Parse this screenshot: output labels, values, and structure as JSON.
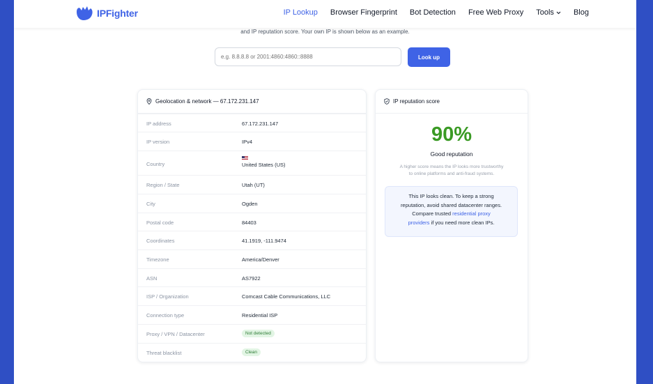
{
  "header": {
    "brand": "IPFighter",
    "nav": [
      {
        "label": "IP Lookup",
        "active": true
      },
      {
        "label": "Browser Fingerprint"
      },
      {
        "label": "Bot Detection"
      },
      {
        "label": "Free Web Proxy"
      },
      {
        "label": "Tools"
      },
      {
        "label": "Blog"
      }
    ]
  },
  "intro": "and IP reputation score. Your own IP is shown below as an example.",
  "search": {
    "placeholder": "e.g. 8.8.8.8 or 2001:4860:4860::8888",
    "button": "Look up"
  },
  "geo": {
    "title": "Geolocation & network — 67.172.231.147",
    "rows": [
      {
        "key": "IP address",
        "value": "67.172.231.147"
      },
      {
        "key": "IP version",
        "value": "IPv4"
      },
      {
        "key": "Country",
        "value": "United States (US)"
      },
      {
        "key": "Region / State",
        "value": "Utah (UT)"
      },
      {
        "key": "City",
        "value": "Ogden"
      },
      {
        "key": "Postal code",
        "value": "84403"
      },
      {
        "key": "Coordinates",
        "value": "41.1919, -111.9474"
      },
      {
        "key": "Timezone",
        "value": "America/Denver"
      },
      {
        "key": "ASN",
        "value": "AS7922"
      },
      {
        "key": "ISP / Organization",
        "value": "Comcast Cable Communications, LLC"
      },
      {
        "key": "Connection type",
        "value": "Residential ISP"
      },
      {
        "key": "Proxy / VPN / Datacenter",
        "value": "Not detected"
      },
      {
        "key": "Threat blacklist",
        "value": "Clean"
      }
    ]
  },
  "reputation": {
    "title": "IP reputation score",
    "score": "90%",
    "label": "Good reputation",
    "desc_line1": "A higher score means the IP looks more trustworthy",
    "desc_line2": "to online platforms and anti-fraud systems.",
    "note_line1": "This IP looks clean. To keep a strong",
    "note_line2": "reputation, avoid shared datacenter ranges.",
    "note_line3": "Compare trusted",
    "note_link_a": "residential proxy",
    "note_link_b": "providers",
    "note_line4_rest": "if you need more clean IPs."
  },
  "colors": {
    "accent": "#3f63e6",
    "score_green": "#3a9a24",
    "outer": "#2f4fc4",
    "badge_bg": "#e2f5e4"
  }
}
